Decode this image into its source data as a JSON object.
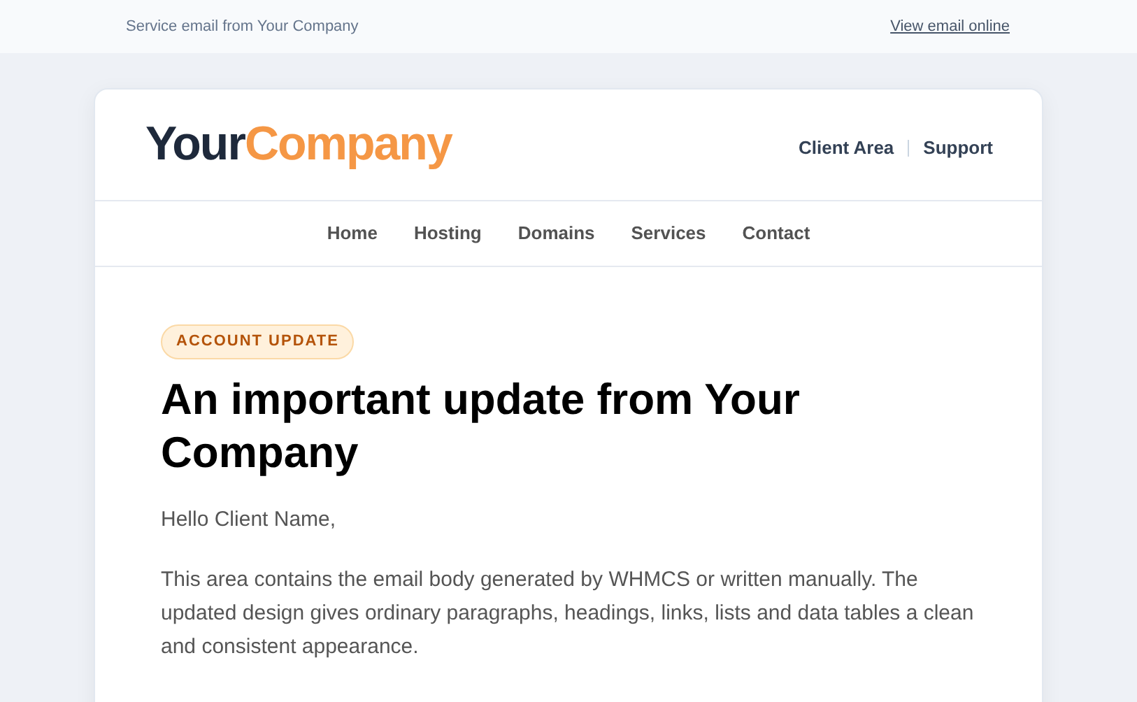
{
  "preheader": {
    "text": "Service email from Your Company",
    "link": "View email online"
  },
  "logo": {
    "part_1": "Your",
    "part_2": "Company"
  },
  "header_links": [
    "Client Area",
    "Support"
  ],
  "nav": [
    "Home",
    "Hosting",
    "Domains",
    "Services",
    "Contact"
  ],
  "badge": "ACCOUNT UPDATE",
  "title": "An important update from Your Company",
  "paragraphs": [
    "Hello Client Name,",
    "This area contains the email body generated by WHMCS or written manually. The updated design gives ordinary paragraphs, headings, links, lists and data tables a clean and consistent appearance."
  ]
}
